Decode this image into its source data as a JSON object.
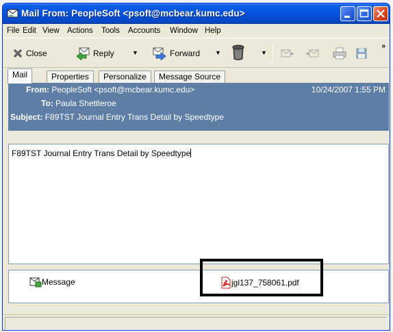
{
  "window": {
    "title": "Mail From: PeopleSoft <psoft@mcbear.kumc.edu>"
  },
  "menu": [
    "File",
    "Edit",
    "View",
    "Actions",
    "Tools",
    "Accounts",
    "Window",
    "Help"
  ],
  "toolbar": {
    "close_label": "Close",
    "reply_label": "Reply",
    "forward_label": "Forward",
    "overflow": "»"
  },
  "tabs": [
    "Mail",
    "Properties",
    "Personalize",
    "Message Source"
  ],
  "header": {
    "from_label": "From:",
    "from_value": "PeopleSoft <psoft@mcbear.kumc.edu>",
    "date": "10/24/2007 1:55 PM",
    "to_label": "To:",
    "to_value": "Paula Shettleroe",
    "subject_label": "Subject:",
    "subject_value": "F89TST  Journal Entry Trans Detail by Speedtype"
  },
  "body_text": "F89TST  Journal Entry Trans Detail by Speedtype",
  "attachments": {
    "message_label": "Message",
    "file_label": "jgl137_758061.pdf"
  },
  "colors": {
    "header_bg": "#5f7ea5",
    "titlebar": "#0553e0"
  }
}
